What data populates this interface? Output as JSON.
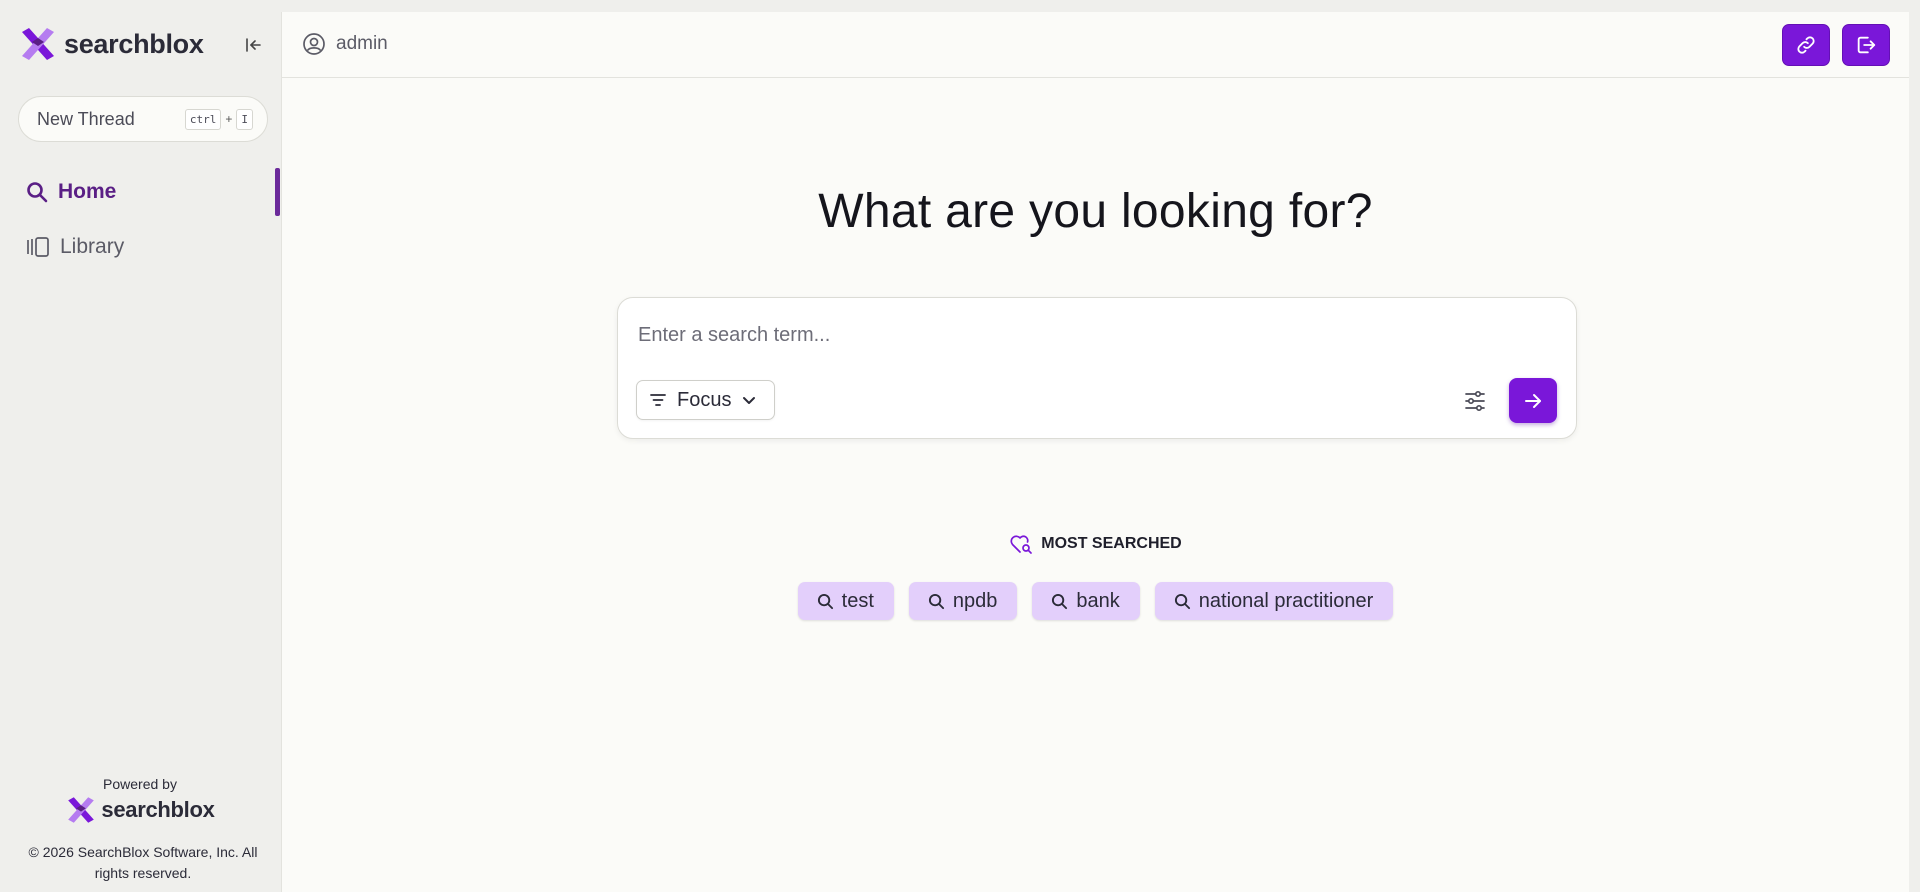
{
  "sidebar": {
    "brand_name": "searchblox",
    "new_thread": {
      "label": "New Thread",
      "shortcut_key1": "ctrl",
      "shortcut_plus": "+",
      "shortcut_key2": "I"
    },
    "nav": [
      {
        "label": "Home",
        "icon": "search-icon",
        "active": true
      },
      {
        "label": "Library",
        "icon": "library-icon",
        "active": false
      }
    ],
    "powered_by": "Powered by",
    "powered_brand": "searchblox",
    "copyright": "© 2026 SearchBlox Software, Inc. All rights reserved."
  },
  "header": {
    "username": "admin",
    "actions": [
      "link-icon",
      "logout-icon"
    ]
  },
  "main": {
    "heading": "What are you looking for?",
    "search": {
      "placeholder": "Enter a search term...",
      "focus_label": "Focus"
    },
    "most_searched": {
      "title": "MOST SEARCHED",
      "terms": [
        "test",
        "npdb",
        "bank",
        "national practitioner"
      ]
    }
  },
  "colors": {
    "accent": "#7a17d9",
    "accent_dark": "#5a1f85",
    "chip_bg": "#e3cffb",
    "panel_bg": "#fbfbf8",
    "sidebar_bg": "#efefec"
  }
}
